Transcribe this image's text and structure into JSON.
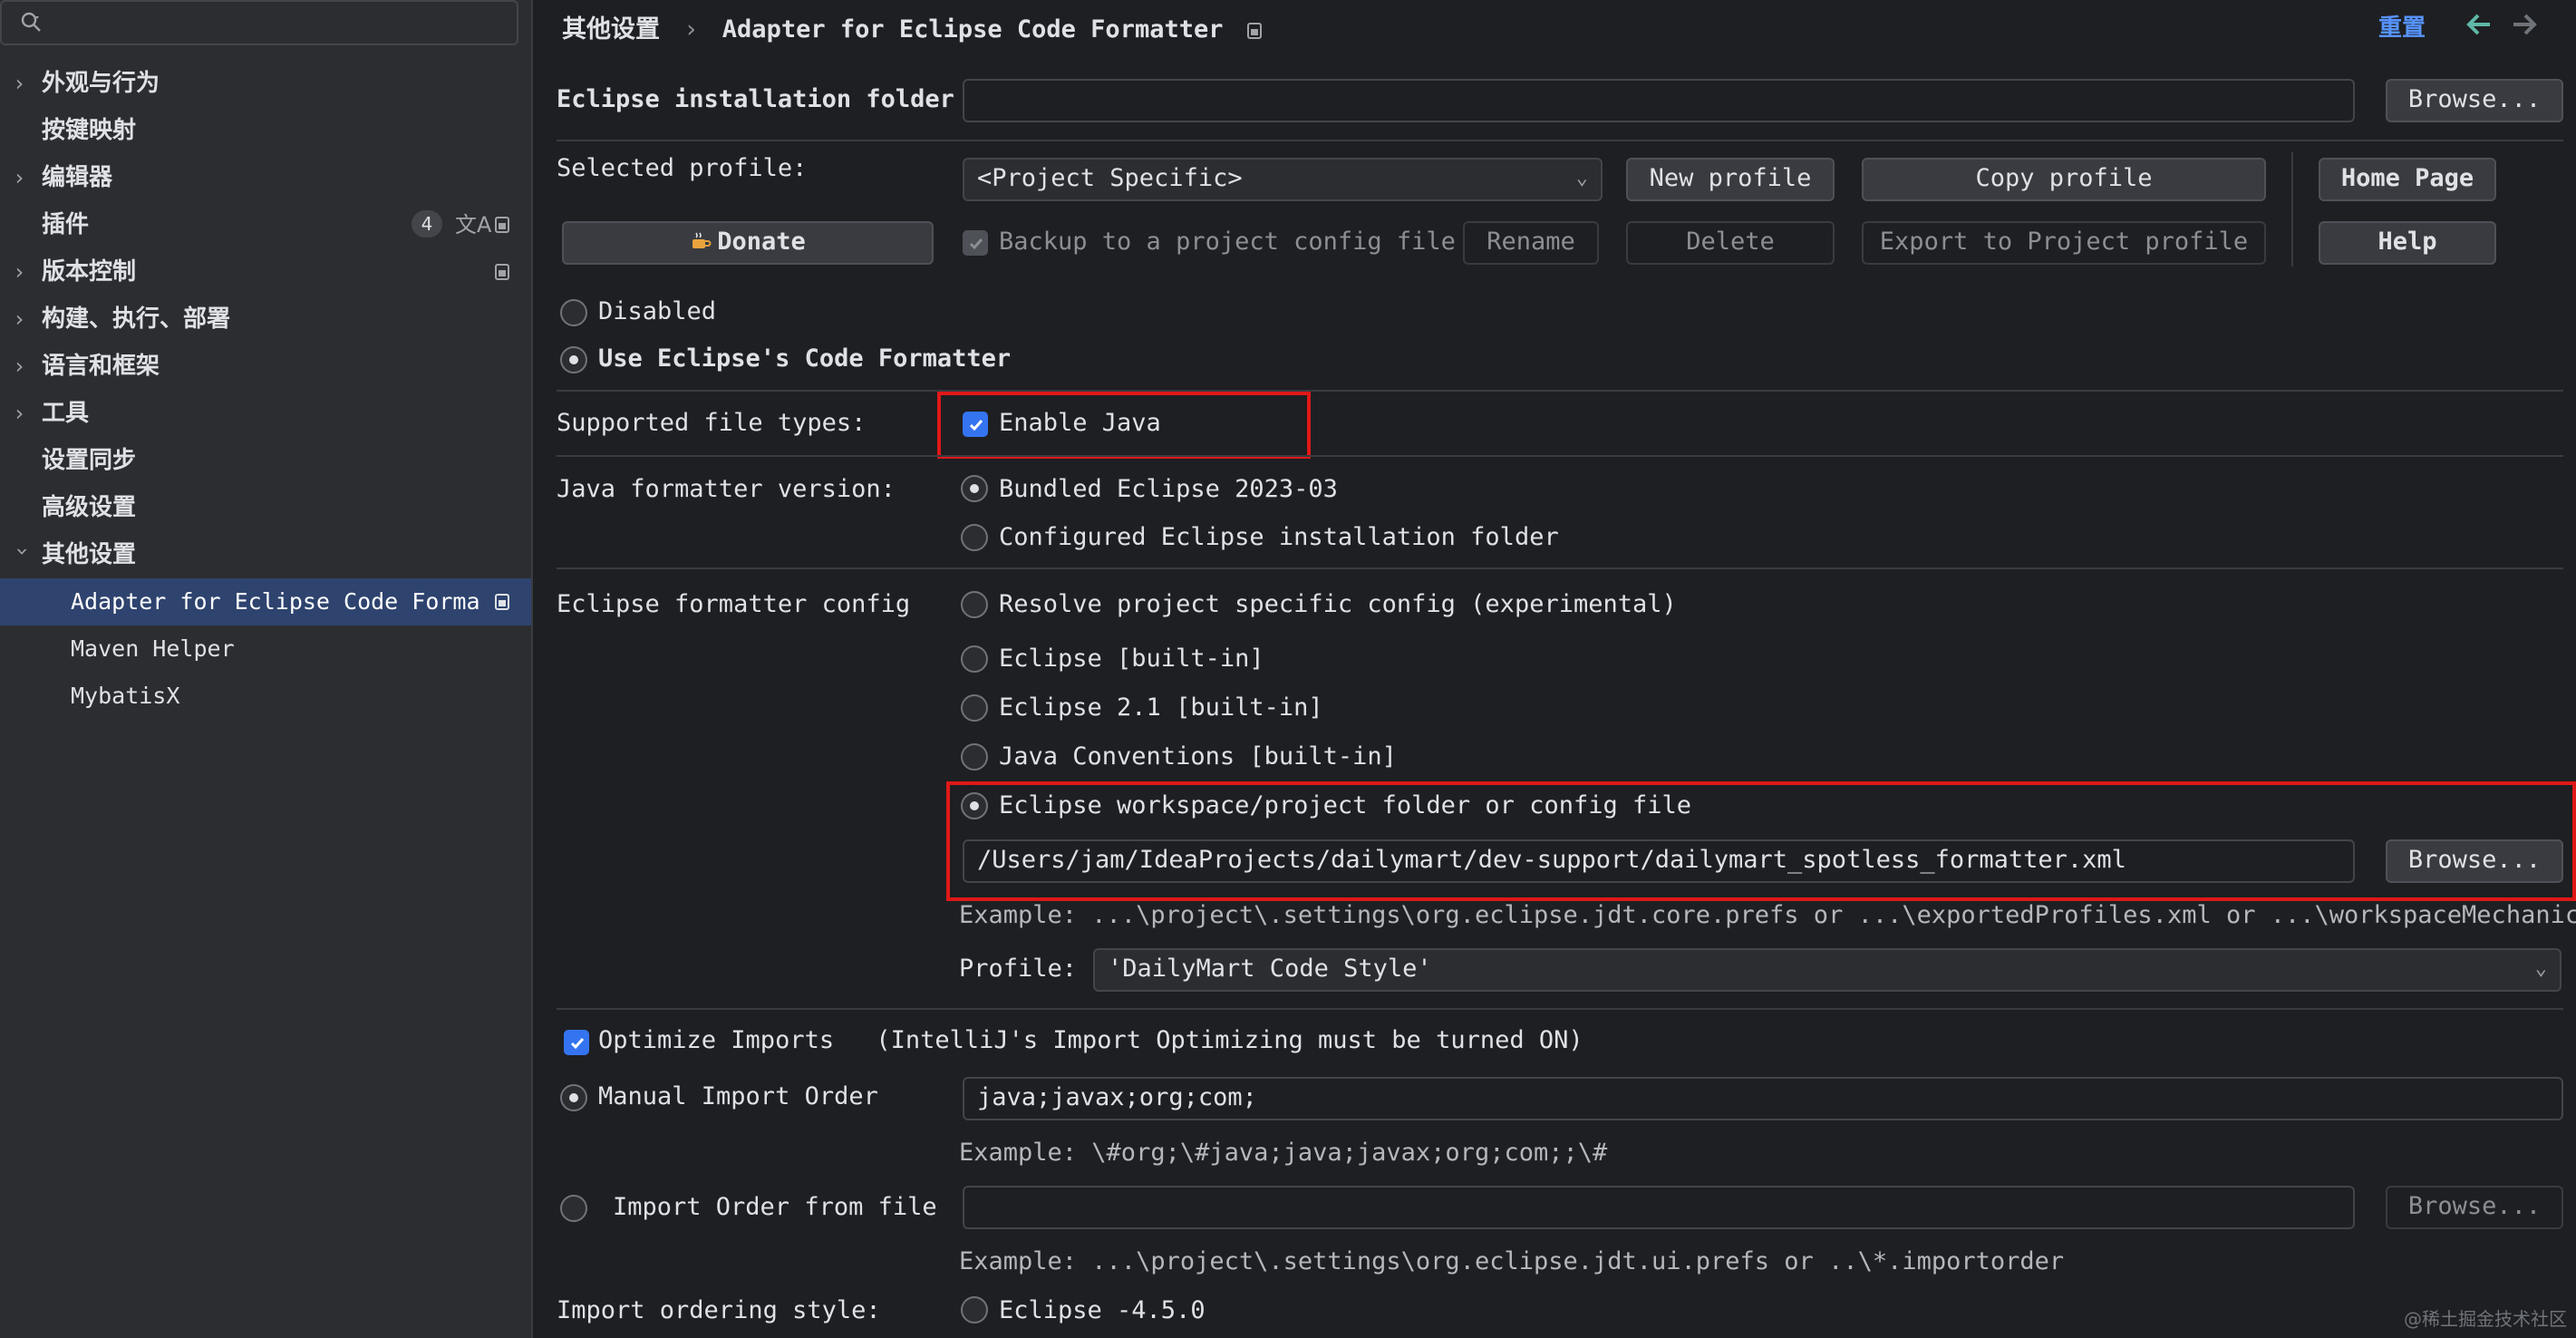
{
  "sidebar": {
    "items": [
      {
        "label": "外观与行为",
        "expandable": true
      },
      {
        "label": "按键映射",
        "expandable": false
      },
      {
        "label": "编辑器",
        "expandable": true
      },
      {
        "label": "插件",
        "expandable": false,
        "badge": "4"
      },
      {
        "label": "版本控制",
        "expandable": true
      },
      {
        "label": "构建、执行、部署",
        "expandable": true
      },
      {
        "label": "语言和框架",
        "expandable": true
      },
      {
        "label": "工具",
        "expandable": true
      },
      {
        "label": "设置同步",
        "expandable": false
      },
      {
        "label": "高级设置",
        "expandable": false
      },
      {
        "label": "其他设置",
        "expandable": true,
        "expanded": true
      }
    ],
    "children": [
      {
        "label": "Adapter for Eclipse Code Forma",
        "selected": true
      },
      {
        "label": "Maven Helper",
        "selected": false
      },
      {
        "label": "MybatisX",
        "selected": false
      }
    ]
  },
  "header": {
    "breadcrumb_parent": "其他设置",
    "breadcrumb_sep": "›",
    "breadcrumb_current": "Adapter for Eclipse Code Formatter",
    "reset_label": "重置"
  },
  "form": {
    "install_folder_label": "Eclipse installation folder",
    "install_folder_value": "",
    "browse_label": "Browse...",
    "selected_profile_label": "Selected profile:",
    "selected_profile_value": "<Project Specific>",
    "new_profile_label": "New profile",
    "copy_profile_label": "Copy profile",
    "home_page_label": "Home Page",
    "donate_label": "Donate",
    "backup_label": "Backup to a project config file",
    "rename_label": "Rename",
    "delete_label": "Delete",
    "export_label": "Export to Project profile",
    "help_label": "Help",
    "disabled_label": "Disabled",
    "use_eclipse_label": "Use Eclipse's Code Formatter",
    "supported_types_label": "Supported file types:",
    "enable_java_label": "Enable Java",
    "java_version_label": "Java formatter version:",
    "bundled_label": "Bundled Eclipse 2023-03",
    "configured_label": "Configured Eclipse installation folder",
    "formatter_config_label": "Eclipse formatter config",
    "opt_resolve": "Resolve project specific config (experimental)",
    "opt_builtin": "Eclipse [built-in]",
    "opt_builtin21": "Eclipse 2.1 [built-in]",
    "opt_java_conv": "Java Conventions [built-in]",
    "opt_workspace": "Eclipse workspace/project folder or config file",
    "config_path": "/Users/jam/IdeaProjects/dailymart/dev-support/dailymart_spotless_formatter.xml",
    "example_config": "Example: ...\\project\\.settings\\org.eclipse.jdt.core.prefs or ...\\exportedProfiles.xml or ...\\workspaceMechanic.epf",
    "profile_label": "Profile:",
    "profile_value": "'DailyMart Code Style'",
    "optimize_imports_label": "Optimize Imports",
    "optimize_imports_note": "(IntelliJ's Import Optimizing must be turned ON)",
    "manual_order_label": "Manual Import Order",
    "manual_order_value": "java;javax;org;com;",
    "example_order": "Example: \\#org;\\#java;java;javax;org;com;;\\#",
    "import_from_file_label": "Import Order from file",
    "import_file_value": "",
    "example_importorder": "Example: ...\\project\\.settings\\org.eclipse.jdt.ui.prefs or ..\\*.importorder",
    "ordering_style_label": "Import ordering style:",
    "ordering_style_value": "Eclipse -4.5.0"
  },
  "watermark": "@稀土掘金技术社区",
  "colors": {
    "accent": "#3574f0",
    "highlight_box": "#e01818",
    "selection": "#2e436e",
    "link": "#5794ff"
  }
}
